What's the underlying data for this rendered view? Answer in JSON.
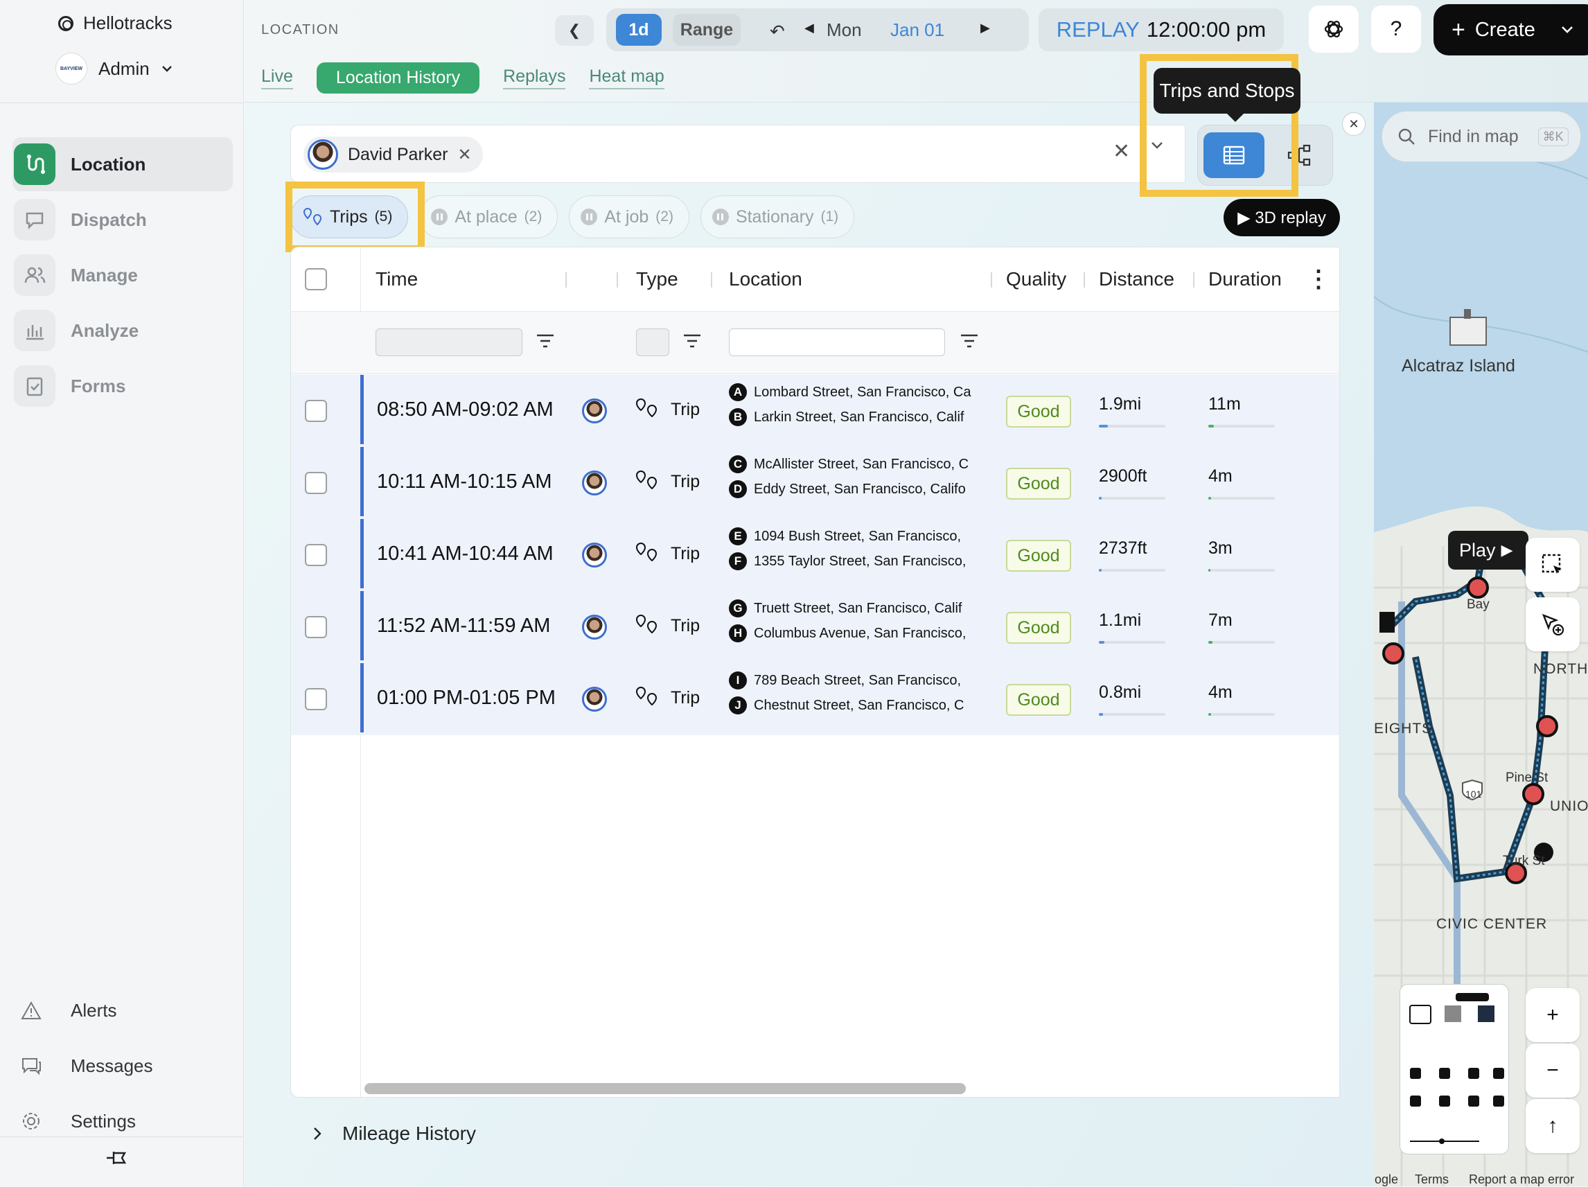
{
  "app": {
    "brand": "Hellotracks",
    "user": "Admin",
    "user_logo_text": "BAYVIEW"
  },
  "nav": {
    "items": [
      {
        "label": "Location",
        "icon": "route-icon"
      },
      {
        "label": "Dispatch",
        "icon": "dispatch-icon"
      },
      {
        "label": "Manage",
        "icon": "people-icon"
      },
      {
        "label": "Analyze",
        "icon": "chart-icon"
      },
      {
        "label": "Forms",
        "icon": "clipboard-icon"
      }
    ],
    "bottom": [
      {
        "label": "Alerts",
        "icon": "alert-icon"
      },
      {
        "label": "Messages",
        "icon": "messages-icon"
      },
      {
        "label": "Settings",
        "icon": "gear-icon"
      }
    ]
  },
  "header": {
    "section": "LOCATION",
    "tabs": [
      "Live",
      "Location History",
      "Replays",
      "Heat map"
    ],
    "period_1d": "1d",
    "period_range": "Range",
    "day": "Mon",
    "date": "Jan 01",
    "replay_label": "REPLAY",
    "replay_time": "12:00:00 pm",
    "help": "?",
    "create_label": "Create"
  },
  "filter": {
    "person": "David Parker"
  },
  "tooltip": "Trips and Stops",
  "filter_chips": [
    {
      "label": "Trips",
      "count": "(5)"
    },
    {
      "label": "At place",
      "count": "(2)"
    },
    {
      "label": "At job",
      "count": "(2)"
    },
    {
      "label": "Stationary",
      "count": "(1)"
    }
  ],
  "replay_3d": "▶ 3D replay",
  "table": {
    "columns": [
      "Time",
      "Type",
      "Location",
      "Quality",
      "Distance",
      "Duration"
    ],
    "rows": [
      {
        "time": "08:50 AM-09:02 AM",
        "type": "Trip",
        "from_letter": "A",
        "from": "Lombard Street, San Francisco, Ca",
        "to_letter": "B",
        "to": "Larkin Street, San Francisco, Calif",
        "quality": "Good",
        "distance": "1.9mi",
        "duration": "11m",
        "dist_frac": 0.14,
        "dur_frac": 0.08
      },
      {
        "time": "10:11 AM-10:15 AM",
        "type": "Trip",
        "from_letter": "C",
        "from": "McAllister Street, San Francisco, C",
        "to_letter": "D",
        "to": "Eddy Street, San Francisco, Califo",
        "quality": "Good",
        "distance": "2900ft",
        "duration": "4m",
        "dist_frac": 0.04,
        "dur_frac": 0.04
      },
      {
        "time": "10:41 AM-10:44 AM",
        "type": "Trip",
        "from_letter": "E",
        "from": "1094 Bush Street, San Francisco,",
        "to_letter": "F",
        "to": "1355 Taylor Street, San Francisco,",
        "quality": "Good",
        "distance": "2737ft",
        "duration": "3m",
        "dist_frac": 0.04,
        "dur_frac": 0.03
      },
      {
        "time": "11:52 AM-11:59 AM",
        "type": "Trip",
        "from_letter": "G",
        "from": "Truett Street, San Francisco, Calif",
        "to_letter": "H",
        "to": "Columbus Avenue, San Francisco,",
        "quality": "Good",
        "distance": "1.1mi",
        "duration": "7m",
        "dist_frac": 0.08,
        "dur_frac": 0.06
      },
      {
        "time": "01:00 PM-01:05 PM",
        "type": "Trip",
        "from_letter": "I",
        "from": "789 Beach Street, San Francisco,",
        "to_letter": "J",
        "to": "Chestnut Street, San Francisco, C",
        "quality": "Good",
        "distance": "0.8mi",
        "duration": "4m",
        "dist_frac": 0.06,
        "dur_frac": 0.04
      }
    ]
  },
  "mileage": "Mileage History",
  "map": {
    "search_placeholder": "Find in map",
    "shortcut": "⌘K",
    "play": "Play",
    "labels": [
      "Alcatraz Island",
      "EIGHTS",
      "NORTH",
      "UNIO",
      "CIVIC CENTER",
      "Pine St",
      "Turk St",
      "Bay",
      "101"
    ],
    "footer": [
      "ogle",
      "Terms",
      "Report a map error"
    ]
  },
  "colors": {
    "accent": "#3e86d6",
    "brand_green": "#37a86e",
    "highlight": "#f4c342",
    "trip_bar": "#3e6ecf"
  }
}
